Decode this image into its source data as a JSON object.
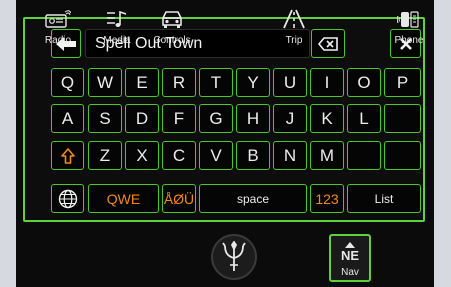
{
  "search": {
    "value": "Spell Out Town"
  },
  "keyboard": {
    "row1": [
      "Q",
      "W",
      "E",
      "R",
      "T",
      "Y",
      "U",
      "I",
      "O",
      "P"
    ],
    "row2": [
      "A",
      "S",
      "D",
      "F",
      "G",
      "H",
      "J",
      "K",
      "L",
      ""
    ],
    "row3": [
      "Z",
      "X",
      "C",
      "V",
      "B",
      "N",
      "M",
      "",
      ""
    ],
    "bottom": {
      "qwe": "QWE",
      "special": "ÅØÜ",
      "space": "space",
      "numbers": "123",
      "list": "List"
    }
  },
  "nav": {
    "items": [
      {
        "label": "Radio",
        "icon": "radio-icon"
      },
      {
        "label": "Media",
        "icon": "media-icon"
      },
      {
        "label": "Controls",
        "icon": "car-icon"
      },
      {
        "label": "Trip",
        "icon": "road-icon"
      },
      {
        "label": "Nav",
        "icon": "compass-icon",
        "direction": "NE",
        "active": true
      },
      {
        "label": "Phone",
        "icon": "phone-icon"
      }
    ]
  },
  "colors": {
    "accent": "#5fd23a",
    "orange": "#f08a1a",
    "background": "#0b0b0b"
  }
}
